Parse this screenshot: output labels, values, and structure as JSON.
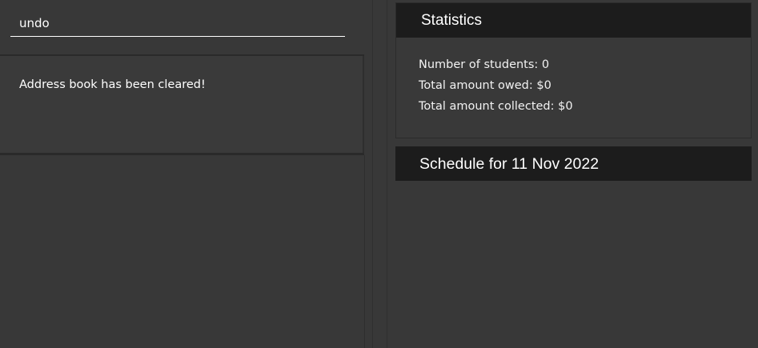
{
  "command_box": {
    "value": "undo"
  },
  "result_display": {
    "message": "Address book has been cleared!"
  },
  "statistics": {
    "title": "Statistics",
    "lines": [
      "Number of students: 0",
      "Total amount owed: $0",
      "Total amount collected: $0"
    ]
  },
  "schedule": {
    "title": "Schedule for 11 Nov 2022"
  },
  "colors": {
    "background": "#383838",
    "header_background": "#1c1c1c",
    "text": "#ffffff"
  }
}
